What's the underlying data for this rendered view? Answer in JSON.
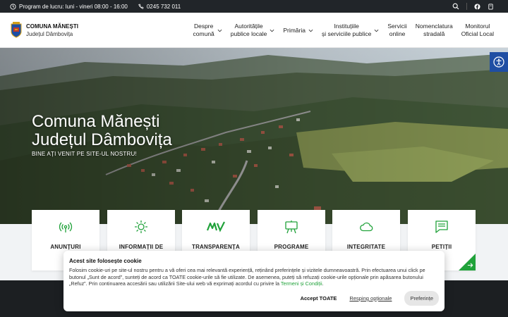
{
  "topbar": {
    "schedule": "Program de lucru: luni - vineri 08:00 - 16:00",
    "phone": "0245 732 011"
  },
  "logo": {
    "title": "COMUNA MĂNEȘTI",
    "subtitle": "Județul Dâmbovița"
  },
  "nav": [
    {
      "line1": "Despre",
      "line2": "comună",
      "dropdown": true
    },
    {
      "line1": "Autoritățile",
      "line2": "publice locale",
      "dropdown": true
    },
    {
      "line1": "Primăria",
      "line2": "",
      "dropdown": true
    },
    {
      "line1": "Instituțiile",
      "line2": "și serviciile publice",
      "dropdown": true
    },
    {
      "line1": "Servicii",
      "line2": "online",
      "dropdown": false
    },
    {
      "line1": "Nomenclatura",
      "line2": "stradală",
      "dropdown": false
    },
    {
      "line1": "Monitorul",
      "line2": "Oficial Local",
      "dropdown": false
    }
  ],
  "hero": {
    "title_line1": "Comuna Mănești",
    "title_line2": "Județul Dâmbovița",
    "subtitle": "BINE AȚI VENIT PE SITE-UL NOSTRU!"
  },
  "cards": [
    {
      "label": "ANUNȚURI",
      "icon": "broadcast-icon"
    },
    {
      "label": "INFORMAȚII DE",
      "icon": "sun-icon"
    },
    {
      "label": "TRANSPARENȚA",
      "icon": "mv-logo-icon"
    },
    {
      "label": "PROGRAME",
      "icon": "easel-icon"
    },
    {
      "label": "INTEGRITATE",
      "icon": "cloud-icon"
    },
    {
      "label": "PETIȚII",
      "icon": "message-icon"
    }
  ],
  "cookie": {
    "title": "Acest site folosește cookie",
    "body": "Folosim cookie-uri pe site-ul nostru pentru a vă oferi cea mai relevantă experiență, reținând preferințele și vizitele dumneavoastră. Prin efectuarea unui click pe butonul „Sunt de acord”, sunteți de acord ca TOATE cookie-urile să fie utilizate. De asemenea, puteți să refuzați cookie-urile opționale prin apăsarea butonului „Refuz”. Prin continuarea accesării sau utilizării Site-ului web vă exprimați acordul cu privire la",
    "link": "Termeni și Condiții",
    "accept": "Accept TOATE",
    "reject": "Resping opționale",
    "prefs": "Preferințe"
  },
  "colors": {
    "accent": "#20a23a",
    "topbar": "#212529",
    "access": "#1f4ea3"
  }
}
